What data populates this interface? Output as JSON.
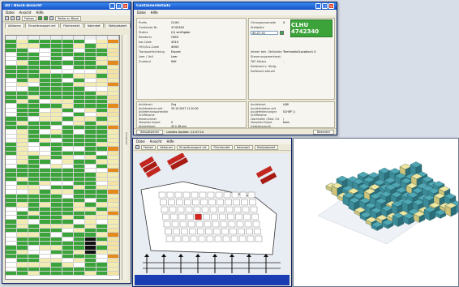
{
  "block_window": {
    "title": "40 / Block-Ansicht",
    "menu": [
      "Datei",
      "Ansicht",
      "Hilfe"
    ],
    "toolbar": {
      "search_label": "Farben",
      "block_label": "Reihe zu Block"
    },
    "tabs": [
      "Aktionen",
      "Einzeltransport erf.",
      "Flächendef.",
      "Kalendef.",
      "Stellplatzdef."
    ],
    "sidebar_label": "Containerl."
  },
  "details_window": {
    "title": "Containerdetails",
    "menu": [
      "Datei",
      "Hilfe"
    ],
    "left_fields": [
      {
        "label": "Prefix",
        "value": "CLHU"
      },
      {
        "label": "Container-Nr.",
        "value": "4742340"
      },
      {
        "label": "Status",
        "value": "(0) verfügbar"
      },
      {
        "label": "Reederei",
        "value": "OEDI"
      },
      {
        "label": "Iso-Code",
        "value": "4310"
      },
      {
        "label": "HYL/ALL-Code",
        "value": "4H00"
      },
      {
        "label": "Transportrichtung",
        "value": "Export"
      },
      {
        "label": "Leer / Voll",
        "value": "Leer"
      },
      {
        "label": "Zustand",
        "value": "INH"
      }
    ],
    "right_fields": [
      {
        "label": "Ortungsanomalie",
        "value": "0"
      },
      {
        "label": "Stellplatz",
        "value": "40.27-01"
      }
    ],
    "right_lower_fields": [
      {
        "label": "letzter bek. Stellplatz:",
        "value": "Terminalid/Location1 0"
      },
      {
        "label": "Steuerungsmerkmal:",
        "value": ""
      },
      {
        "label": "TAF-Status",
        "value": "."
      },
      {
        "label": "Sollstand z. Steig.",
        "value": ""
      },
      {
        "label": "Sollstand aktuell",
        "value": ""
      }
    ],
    "badge_text": "CLHU 4742340",
    "arrival_fields": [
      {
        "label": "Anlieferart",
        "value": "Zug"
      },
      {
        "label": "Anlieferdatum.zeit",
        "value": "30.10.2007 11:10:00"
      },
      {
        "label": "Anliefertransportmittel",
        "value": ""
      },
      {
        "label": "Schiffsname",
        "value": ""
      },
      {
        "label": "Reisenummer",
        "value": ""
      },
      {
        "label": "Stauplatz Import",
        "value": "0"
      },
      {
        "label": "Verweildauer",
        "value": "42 h 48 min"
      }
    ],
    "departure_fields": [
      {
        "label": "Auslieferart",
        "value": "LKW"
      },
      {
        "label": "Auslieferdatum.zeit",
        "value": ""
      },
      {
        "label": "Auslieferkennung/nr",
        "value": "SCHIFF ()"
      },
      {
        "label": "Schiffsname",
        "value": ""
      },
      {
        "label": "Löschhafen / Best. Ort",
        "value": "/"
      },
      {
        "label": "Stauplatz Export",
        "value": "beim"
      },
      {
        "label": "Freistellungs-Nr",
        "value": ""
      }
    ],
    "status_left": "Aktualisieren",
    "status_mid": "Letztes Update: 11:07:24",
    "close_button": "Beenden"
  },
  "yard_window": {
    "menu": [
      "Datei",
      "Ansicht",
      "Hilfe"
    ],
    "toolbar": {
      "colors": "Farben",
      "actions": "Aktionen",
      "transport": "Einzeltransport erf.",
      "area": "Flächendef.",
      "calendar": "Kalendef.",
      "stellplatz": "Stellplatzdef."
    }
  },
  "colors": {
    "green": "#3aa43a",
    "yellow": "#f2ecb0",
    "black": "#111111",
    "orange": "#e38a1a",
    "blue": "#1a3db4"
  }
}
